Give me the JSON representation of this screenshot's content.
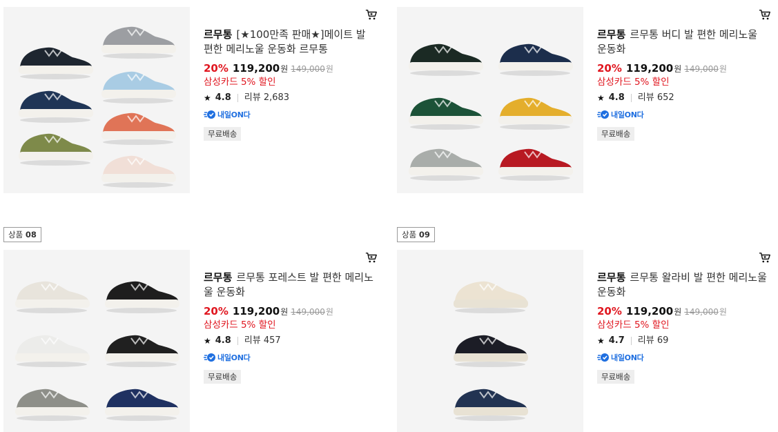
{
  "products": [
    {
      "brand": "르무통",
      "name": "[★100만족 판매★]메이트 발 편한 메리노울 운동화 르무통",
      "discount": "20%",
      "price": "119,200",
      "currency": "원",
      "original_price": "149,000",
      "card_promo": "삼성카드 5% 할인",
      "rating": "4.8",
      "review": "리뷰 2,683",
      "delivery": "내일ON다",
      "badge": "무료배송",
      "shoe_colors": [
        "#1e2630",
        "#9c9ea2",
        "#1f3556",
        "#a9cce4",
        "#7e8a4a",
        "#e07457",
        "#f1dfd7"
      ]
    },
    {
      "brand": "르무통",
      "name": "르무통 버디 발 편한 메리노울 운동화",
      "discount": "20%",
      "price": "119,200",
      "currency": "원",
      "original_price": "149,000",
      "card_promo": "삼성카드 5% 할인",
      "rating": "4.8",
      "review": "리뷰 652",
      "delivery": "내일ON다",
      "badge": "무료배송",
      "shoe_colors": [
        "#1b2a24",
        "#1c2e4c",
        "#1c5238",
        "#e4ae2c",
        "#a9adaa",
        "#b81a22"
      ]
    },
    {
      "label_prefix": "상품",
      "label_number": "08",
      "brand": "르무통",
      "name": "르무통 포레스트 발 편한 메리노울 운동화",
      "discount": "20%",
      "price": "119,200",
      "currency": "원",
      "original_price": "149,000",
      "card_promo": "삼성카드 5% 할인",
      "rating": "4.8",
      "review": "리뷰 457",
      "delivery": "내일ON다",
      "badge": "무료배송",
      "shoe_colors": [
        "#e8e4dc",
        "#1e1e1e",
        "#ececea",
        "#202020",
        "#8e8f89",
        "#1f3161"
      ]
    },
    {
      "label_prefix": "상품",
      "label_number": "09",
      "brand": "르무통",
      "name": "르무통 왈라비 발 편한 메리노울 운동화",
      "discount": "20%",
      "price": "119,200",
      "currency": "원",
      "original_price": "149,000",
      "card_promo": "삼성카드 5% 할인",
      "rating": "4.7",
      "review": "리뷰 69",
      "delivery": "내일ON다",
      "badge": "무료배송",
      "shoe_colors": [
        "#ece3d2",
        "#1c1d26",
        "#223352"
      ]
    }
  ],
  "colors": {
    "discount": "#e0161f",
    "delivery": "#1f6fe0",
    "badge_bg": "#eeeeee"
  },
  "icons": {
    "cart": "cart-icon",
    "star": "star-icon",
    "delivery": "rocket-delivery-icon"
  }
}
